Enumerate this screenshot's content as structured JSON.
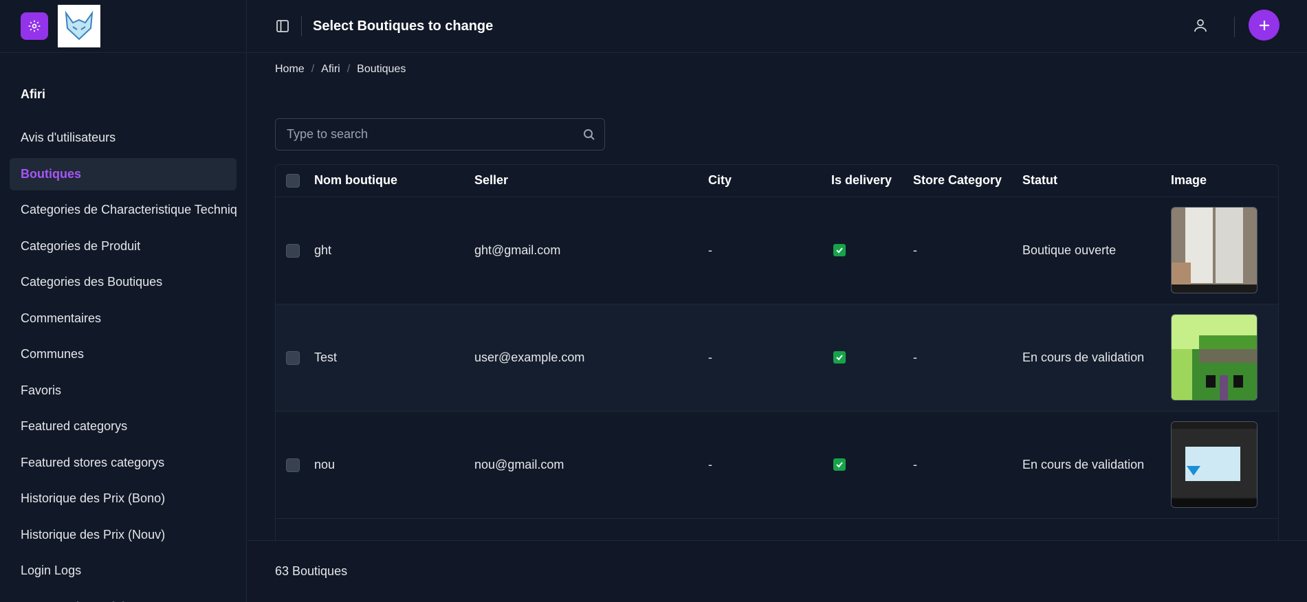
{
  "page": {
    "title": "Select Boutiques to change"
  },
  "breadcrumb": {
    "items": [
      "Home",
      "Afiri",
      "Boutiques"
    ],
    "separator": "/"
  },
  "sidebar": {
    "section": "Afiri",
    "items": [
      {
        "label": "Avis d'utilisateurs",
        "active": false
      },
      {
        "label": "Boutiques",
        "active": true
      },
      {
        "label": "Categories de Characteristique Techniques",
        "active": false
      },
      {
        "label": "Categories de Produit",
        "active": false
      },
      {
        "label": "Categories des Boutiques",
        "active": false
      },
      {
        "label": "Commentaires",
        "active": false
      },
      {
        "label": "Communes",
        "active": false
      },
      {
        "label": "Favoris",
        "active": false
      },
      {
        "label": "Featured categorys",
        "active": false
      },
      {
        "label": "Featured stores categorys",
        "active": false
      },
      {
        "label": "Historique des Prix (Bono)",
        "active": false
      },
      {
        "label": "Historique des Prix (Nouv)",
        "active": false
      },
      {
        "label": "Login Logs",
        "active": false
      },
      {
        "label": "Marques des Prduits",
        "active": false
      }
    ]
  },
  "search": {
    "placeholder": "Type to search",
    "value": ""
  },
  "table": {
    "headers": [
      "Nom boutique",
      "Seller",
      "City",
      "Is delivery",
      "Store Category",
      "Statut",
      "Image"
    ],
    "rows": [
      {
        "nom": "ght",
        "seller": "ght@gmail.com",
        "city": "-",
        "is_delivery": true,
        "store_category": "-",
        "statut": "Boutique ouverte",
        "image": "photo-of-tubes"
      },
      {
        "nom": "Test",
        "seller": "user@example.com",
        "city": "-",
        "is_delivery": true,
        "store_category": "-",
        "statut": "En cours de validation",
        "image": "pixel-art-green"
      },
      {
        "nom": "nou",
        "seller": "nou@gmail.com",
        "city": "-",
        "is_delivery": true,
        "store_category": "-",
        "statut": "En cours de validation",
        "image": "photo-of-laptop-screen"
      }
    ]
  },
  "footer": {
    "count_label": "63 Boutiques"
  },
  "colors": {
    "accent": "#9333ea",
    "active_text": "#a855f7",
    "background": "#111827",
    "check": "#16a34a"
  }
}
